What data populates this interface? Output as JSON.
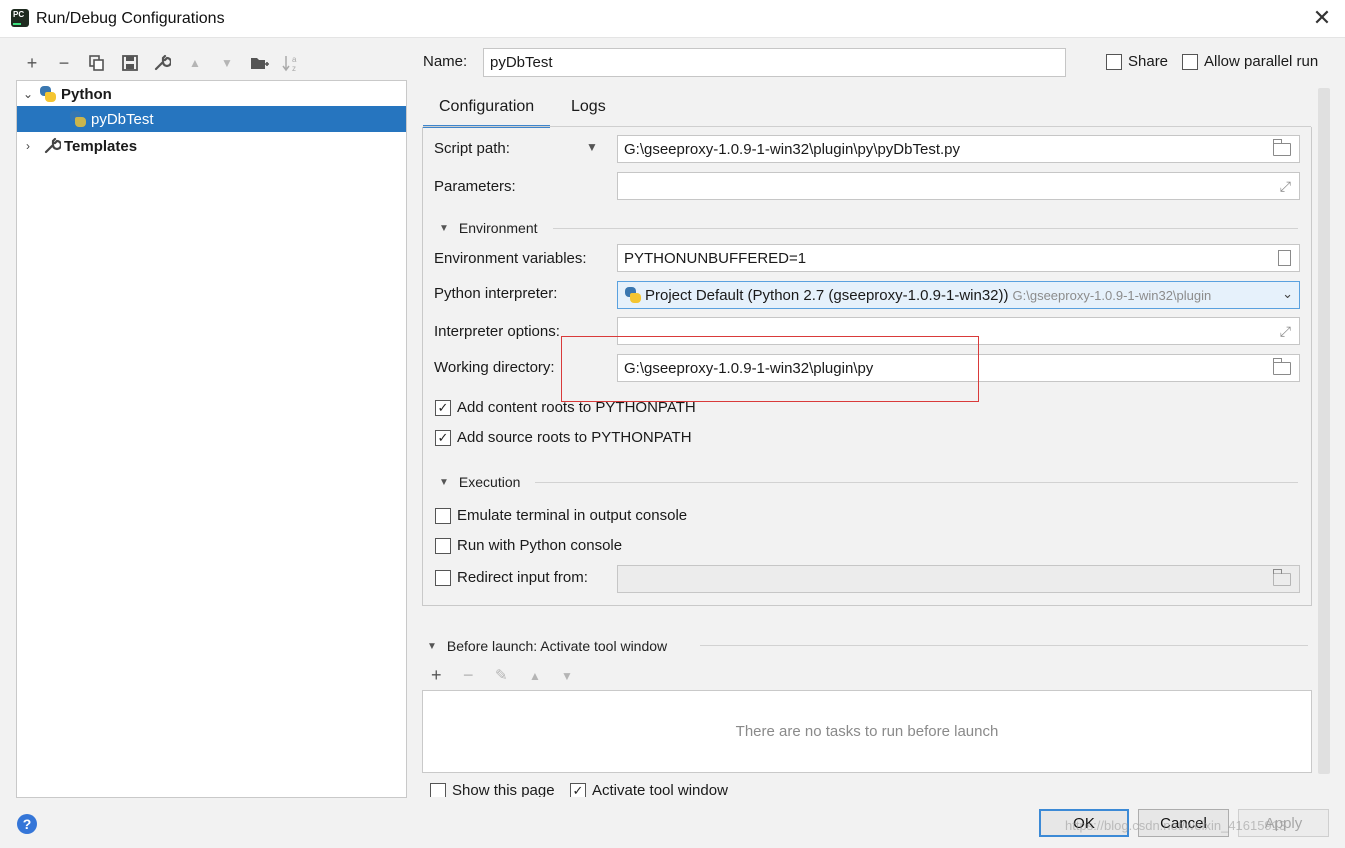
{
  "window": {
    "title": "Run/Debug Configurations",
    "app_icon_text": "PC"
  },
  "toolbar": {
    "add": "+",
    "remove": "−",
    "copy": "⧉",
    "save": "🖫",
    "edit": "🔧",
    "up": "▲",
    "down": "▼",
    "folder": "📁",
    "sort": "↓a z"
  },
  "tree": {
    "python_label": "Python",
    "config_label": "pyDbTest",
    "templates_label": "Templates"
  },
  "header": {
    "name_label": "Name:",
    "name_value": "pyDbTest",
    "share_label": "Share",
    "share_checked": false,
    "parallel_label": "Allow parallel run",
    "parallel_checked": false
  },
  "tabs": [
    {
      "label": "Configuration"
    },
    {
      "label": "Logs"
    }
  ],
  "config": {
    "script_path_label": "Script path:",
    "script_path_value": "G:\\gseeproxy-1.0.9-1-win32\\plugin\\py\\pyDbTest.py",
    "parameters_label": "Parameters:",
    "parameters_value": "",
    "environment_section": "Environment",
    "env_vars_label": "Environment variables:",
    "env_vars_value": "PYTHONUNBUFFERED=1",
    "interpreter_label": "Python interpreter:",
    "interpreter_value": "Project Default (Python 2.7 (gseeproxy-1.0.9-1-win32))",
    "interpreter_path": "G:\\gseeproxy-1.0.9-1-win32\\plugin",
    "interp_options_label": "Interpreter options:",
    "interp_options_value": "",
    "working_dir_label": "Working directory:",
    "working_dir_value": "G:\\gseeproxy-1.0.9-1-win32\\plugin\\py",
    "content_roots_label": "Add content roots to PYTHONPATH",
    "content_roots_checked": true,
    "source_roots_label": "Add source roots to PYTHONPATH",
    "source_roots_checked": true,
    "execution_section": "Execution",
    "emulate_terminal_label": "Emulate terminal in output console",
    "emulate_terminal_checked": false,
    "python_console_label": "Run with Python console",
    "python_console_checked": false,
    "redirect_label": "Redirect input from:",
    "redirect_checked": false,
    "redirect_value": ""
  },
  "before_launch": {
    "title": "Before launch: Activate tool window",
    "empty_text": "There are no tasks to run before launch",
    "show_page_label": "Show this page",
    "show_page_checked": false,
    "activate_label": "Activate tool window",
    "activate_checked": true
  },
  "buttons": {
    "ok": "OK",
    "cancel": "Cancel",
    "apply": "Apply",
    "help": "?"
  },
  "watermark": "https://blog.csdn.net/weixin_41615913",
  "colors": {
    "selection": "#2675bf",
    "annotation_box": "#d93a3a",
    "tab_underline": "#3f86cc"
  }
}
